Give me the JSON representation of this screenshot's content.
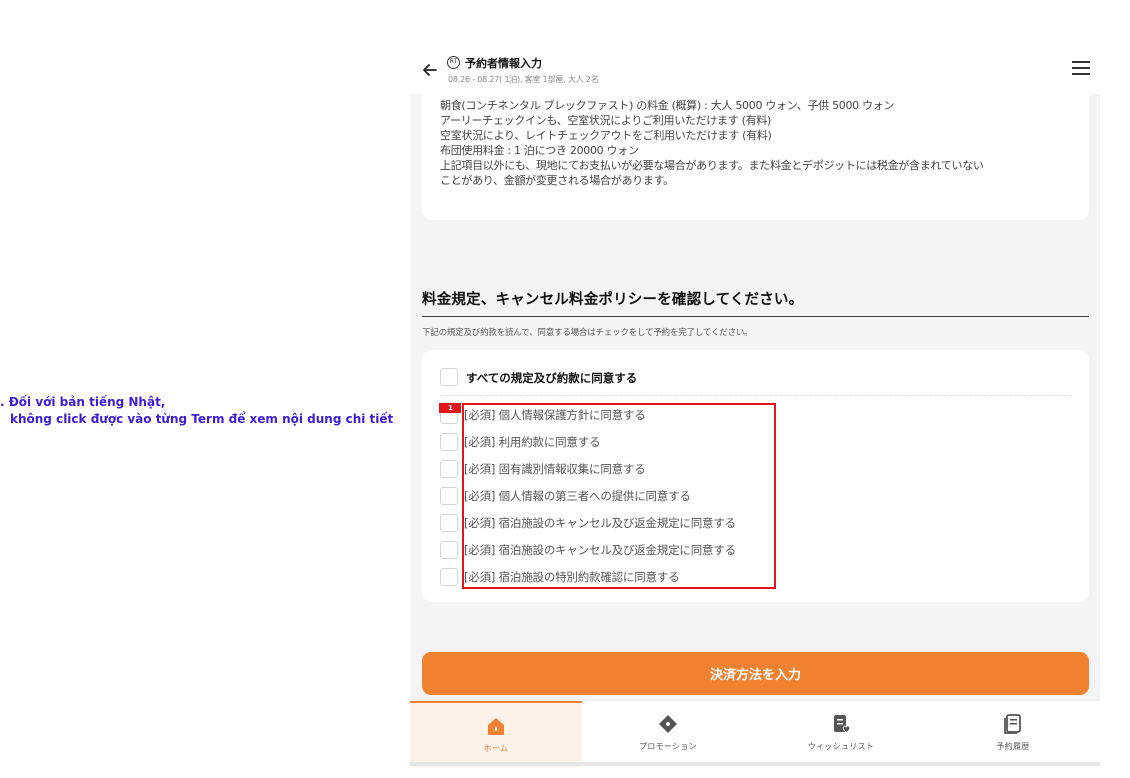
{
  "annotation": {
    "line1": ". Đối với bản tiếng Nhật,",
    "line2": "không click được vào  từng Term để xem nội dung chi tiết"
  },
  "header": {
    "title": "予約者情報入力",
    "subtitle": "08.26 - 08.27( 1泊), 客室 1部屋, 大人 2名",
    "badge_text": "RT"
  },
  "info_lines": [
    "朝食(コンチネンタル ブレックファスト) の料金 (概算) : 大人 5000 ウォン、子供 5000 ウォン",
    "アーリーチェックインも、空室状況によりご利用いただけます (有料)",
    "空室状況により、レイトチェックアウトをご利用いただけます (有料)",
    "布団使用料金 : 1 泊につき 20000 ウォン",
    "上記項目以外にも、現地にてお支払いが必要な場合があります。また料金とデポジットには税金が含まれていない",
    "ことがあり、金額が変更される場合があります。"
  ],
  "section": {
    "title": "料金規定、キャンセル料金ポリシーを確認してください。",
    "note": "下記の規定及び約款を読んで、同意する場合はチェックをして予約を完了してください。"
  },
  "terms": {
    "all_label": "すべての規定及び約款に同意する",
    "items": [
      "[必須] 個人情報保護方針に同意する",
      "[必須] 利用約款に同意する",
      "[必須] 固有識別情報収集に同意する",
      "[必須] 個人情報の第三者への提供に同意する",
      "[必須] 宿泊施設のキャンセル及び返金規定に同意する",
      "[必須] 宿泊施設のキャンセル及び返金規定に同意する",
      "[必須] 宿泊施設の特別約款確認に同意する"
    ]
  },
  "marker": {
    "number": "1"
  },
  "pay_button": "決済方法を入力",
  "nav": {
    "home": "ホーム",
    "promotion": "プロモーション",
    "wishlist": "ウィッシュリスト",
    "history": "予約履歴"
  },
  "colors": {
    "accent": "#f08231",
    "annotation": "#3b1fd6",
    "highlight": "#e0161b"
  }
}
